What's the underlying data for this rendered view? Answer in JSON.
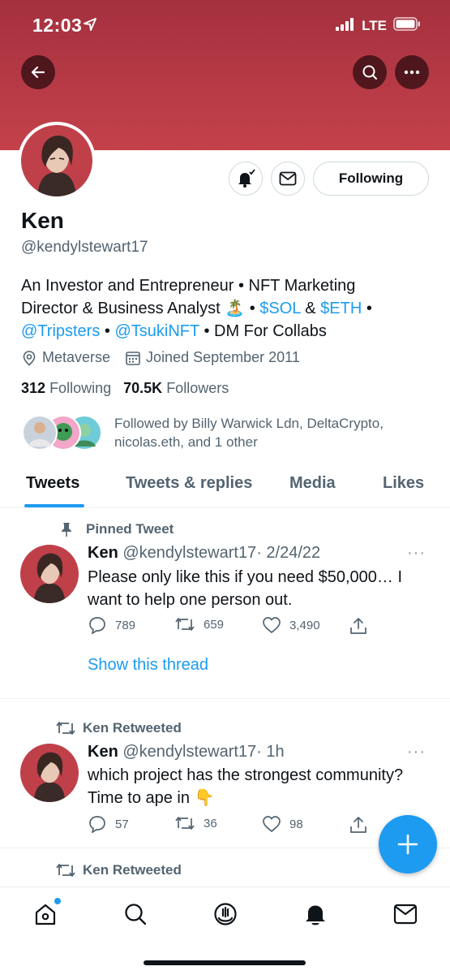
{
  "status_bar": {
    "time": "12:03",
    "network": "LTE"
  },
  "profile": {
    "name": "Ken",
    "handle": "@kendylstewart17",
    "following_button": "Following",
    "bio": {
      "line1": "An Investor and Entrepreneur • NFT Marketing",
      "line2_prefix": "Director & Business Analyst",
      "line2_emoji": "🏝️",
      "line2_sep": "•",
      "sol": "$SOL",
      "amp": "&",
      "eth": "$ETH",
      "line2_end": "•",
      "tripsters": "@Tripsters",
      "dot": "•",
      "tsuki": "@TsukiNFT",
      "line3_end": "• DM For Collabs"
    },
    "location": "Metaverse",
    "joined": "Joined September 2011",
    "following_count": "312",
    "following_label": "Following",
    "followers_count": "70.5K",
    "followers_label": "Followers",
    "followed_by": "Followed by Billy Warwick Ldn, DeltaCrypto, nicolas.eth, and 1 other"
  },
  "tabs": [
    "Tweets",
    "Tweets & replies",
    "Media",
    "Likes"
  ],
  "tweets": [
    {
      "label": "Pinned Tweet",
      "author": "Ken",
      "handle": "@kendylstewart17",
      "time": "· 2/24/22",
      "text": "Please only like this if you need $50,000… I want to help one person out.",
      "replies": "789",
      "retweets": "659",
      "likes": "3,490",
      "show_thread": "Show this thread"
    },
    {
      "label": "Ken Retweeted",
      "author": "Ken",
      "handle": "@kendylstewart17",
      "time": "· 1h",
      "text": "which project has the strongest community? Time to ape in 👇",
      "replies": "57",
      "retweets": "36",
      "likes": "98"
    },
    {
      "label": "Ken Retweeted"
    }
  ],
  "colors": {
    "header": "#b63a46",
    "accent": "#1d9bf0"
  }
}
